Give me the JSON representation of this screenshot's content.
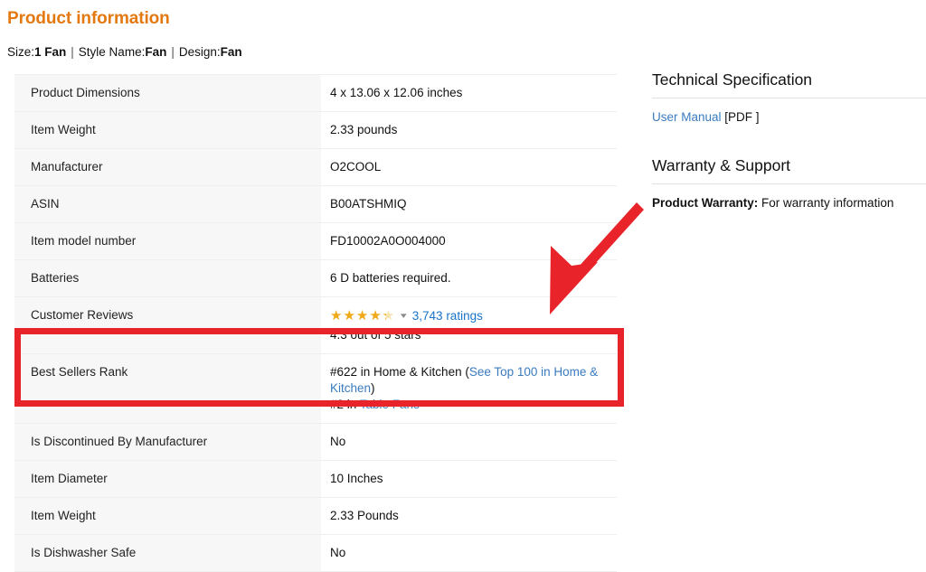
{
  "page": {
    "title": "Product information",
    "title_color": "#E47911"
  },
  "variation": {
    "size_label": "Size:",
    "size_value": "1 Fan",
    "style_label": "Style Name:",
    "style_value": "Fan",
    "design_label": "Design:",
    "design_value": "Fan",
    "separator": "|"
  },
  "detail_table": {
    "rows": [
      {
        "key": "Product Dimensions",
        "value": "4 x 13.06 x 12.06 inches"
      },
      {
        "key": "Item Weight",
        "value": "2.33 pounds"
      },
      {
        "key": "Manufacturer",
        "value": "O2COOL"
      },
      {
        "key": "ASIN",
        "value": "B00ATSHMIQ"
      },
      {
        "key": "Item model number",
        "value": "FD10002A0O004000"
      },
      {
        "key": "Batteries",
        "value": "6 D batteries required."
      }
    ],
    "reviews_row": {
      "key": "Customer Reviews",
      "stars_value": 4.3,
      "stars_filled_percent": "86%",
      "ratings_count_label": "3,743 ratings",
      "out_of_text": "4.3 out of 5 stars",
      "caret": "⌄"
    },
    "bestsellers_row": {
      "key": "Best Sellers Rank",
      "line1_prefix": "#622 in Home & Kitchen (",
      "line1_link": "See Top 100 in Home & Kitchen",
      "line1_suffix": ")",
      "line2_prefix": "#2 in ",
      "line2_link": "Table Fans"
    },
    "rows_after": [
      {
        "key": "Is Discontinued By Manufacturer",
        "value": "No"
      },
      {
        "key": "Item Diameter",
        "value": "10 Inches"
      },
      {
        "key": "Item Weight",
        "value": "2.33 Pounds"
      },
      {
        "key": "Is Dishwasher Safe",
        "value": "No"
      }
    ]
  },
  "right_column": {
    "tech_spec": {
      "heading": "Technical Specification",
      "link_text": "User Manual",
      "suffix_text": "[PDF ]"
    },
    "warranty": {
      "heading": "Warranty & Support",
      "bold_label": "Product Warranty:",
      "text": "For warranty information"
    }
  },
  "annotations": {
    "highlight_box_color": "#e8242a",
    "arrow_color": "#e8242a",
    "arrow_start": "712,232",
    "arrow_end": "608,348"
  }
}
